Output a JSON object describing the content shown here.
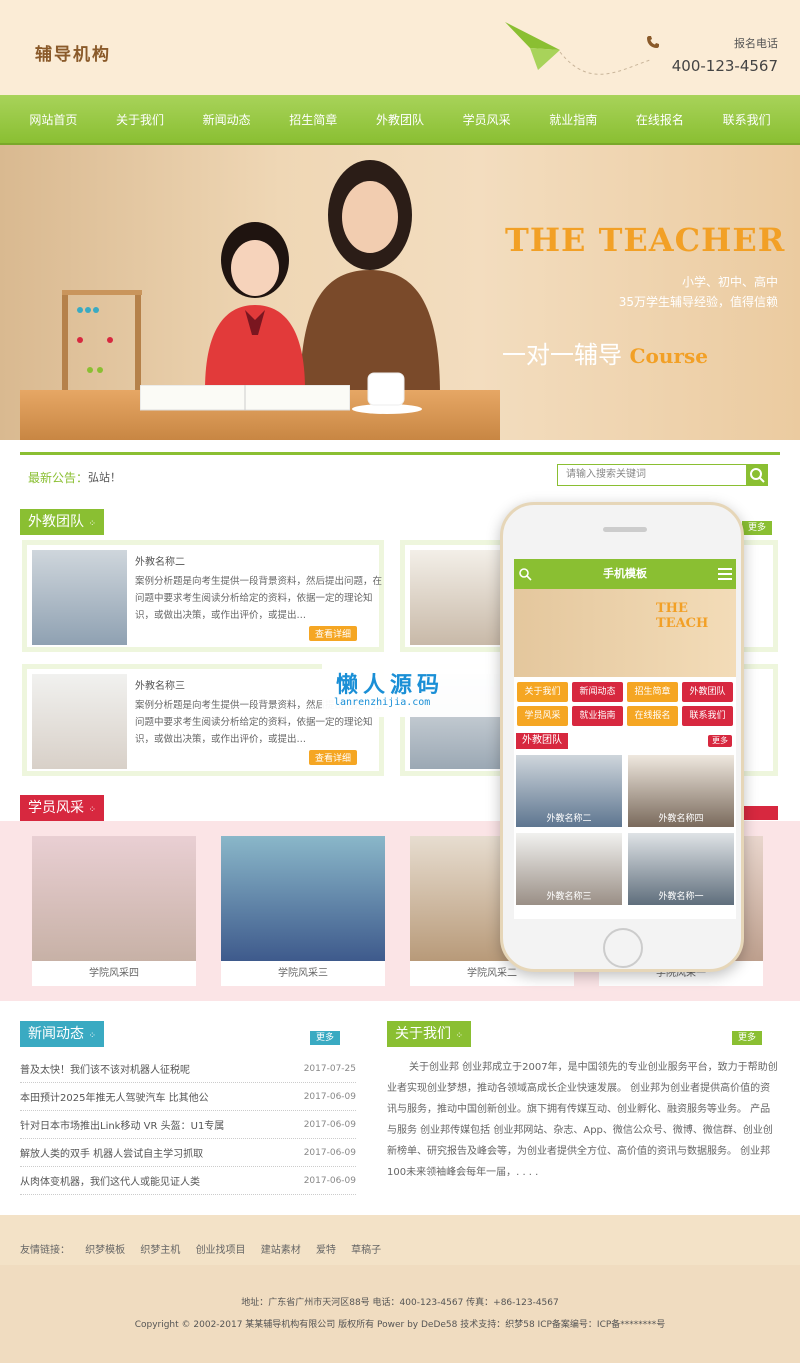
{
  "header": {
    "logo": "辅导机构",
    "phone_label": "报名电话",
    "phone_number": "400-123-4567"
  },
  "nav": [
    "网站首页",
    "关于我们",
    "新闻动态",
    "招生简章",
    "外教团队",
    "学员风采",
    "就业指南",
    "在线报名",
    "联系我们"
  ],
  "banner": {
    "title_en": "THE TEACHER",
    "line1": "小学、初中、高中",
    "line2": "35万学生辅导经验，值得信赖",
    "slogan": "一对一辅导",
    "slogan_en": "Course"
  },
  "notice": {
    "label": "最新公告：",
    "text": "弘站！",
    "search_placeholder": "请输入搜索关键词"
  },
  "teachers": {
    "title": "外教团队",
    "more": "更多",
    "cards": [
      {
        "name": "外教名称二",
        "desc": "案例分析题是向考生提供一段背景资料，然后提出问题，在问题中要求考生阅读分析给定的资料，依据一定的理论知识，或做出决策，或作出评价，或提出…",
        "btn": "查看详细"
      },
      {
        "name": "外教名称三",
        "desc": "案例分析题是向考生提供一段背景资料，然后提出问题，在问题中要求考生阅读分析给定的资料，依据一定的理论知识，或做出决策，或作出评价，或提出…",
        "btn": "查看详细"
      }
    ]
  },
  "students": {
    "title": "学员风采",
    "photos": [
      "学院风采四",
      "学院风采三",
      "学院风采二",
      "学院风采一"
    ]
  },
  "news": {
    "title": "新闻动态",
    "more": "更多",
    "items": [
      {
        "title": "普及太快！我们该不该对机器人征税呢",
        "date": "2017-07-25"
      },
      {
        "title": "本田预计2025年推无人驾驶汽车 比其他公",
        "date": "2017-06-09"
      },
      {
        "title": "针对日本市场推出Link移动 VR 头盔：U1专属",
        "date": "2017-06-09"
      },
      {
        "title": "解放人类的双手 机器人尝试自主学习抓取",
        "date": "2017-06-09"
      },
      {
        "title": "从肉体变机器，我们这代人或能见证人类",
        "date": "2017-06-09"
      }
    ]
  },
  "about": {
    "title": "关于我们",
    "more": "更多",
    "text": "关于创业邦 创业邦成立于2007年，是中国领先的专业创业服务平台，致力于帮助创业者实现创业梦想，推动各领域高成长企业快速发展。 创业邦为创业者提供高价值的资讯与服务，推动中国创新创业。旗下拥有传媒互动、创业孵化、融资服务等业务。 产品与服务 创业邦传媒包括 创业邦网站、杂志、App、微信公众号、微博、微信群、创业创新榜单、研究报告及峰会等，为创业者提供全方位、高价值的资讯与数据服务。 创业邦100未来领袖峰会每年一届，. . . ."
  },
  "friend_links": {
    "label": "友情链接：",
    "items": [
      "织梦模板",
      "织梦主机",
      "创业找项目",
      "建站素材",
      "爱特",
      "草稿子"
    ]
  },
  "footer": {
    "line1": "地址：广东省广州市天河区88号  电话：400-123-4567  传真：+86-123-4567",
    "line2": "Copyright © 2002-2017 某某辅导机构有限公司 版权所有 Power by DeDe58  技术支持：织梦58  ICP备案编号：ICP备********号"
  },
  "mobile": {
    "title": "手机模板",
    "banner_title": "THE TEACH",
    "menu": [
      "关于我们",
      "新闻动态",
      "招生简章",
      "外教团队",
      "学员风采",
      "就业指南",
      "在线报名",
      "联系我们"
    ],
    "section": "外教团队",
    "more": "更多",
    "photos": [
      "外教名称二",
      "外教名称四",
      "外教名称三",
      "外教名称一"
    ]
  },
  "watermark": {
    "cn": "懒人源码",
    "en": "lanrenzhijia.com"
  },
  "colors": {
    "green": "#8abf32",
    "pink": "#d7283f",
    "orange": "#f5a623",
    "teal": "#3aaac2",
    "cream": "#fbecd6"
  }
}
